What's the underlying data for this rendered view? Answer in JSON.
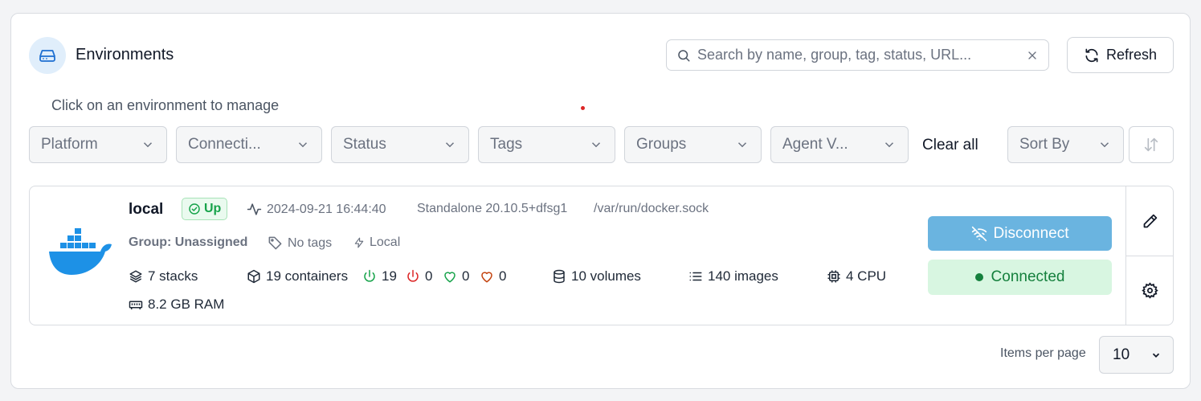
{
  "header": {
    "title": "Environments",
    "subtitle": "Click on an environment to manage",
    "search_placeholder": "Search by name, group, tag, status, URL...",
    "refresh_label": "Refresh"
  },
  "filters": {
    "items": [
      "Platform",
      "Connecti...",
      "Status",
      "Tags",
      "Groups",
      "Agent V..."
    ],
    "clear_all": "Clear all",
    "sort_by": "Sort By"
  },
  "environment": {
    "name": "local",
    "status": "Up",
    "heartbeat": "2024-09-21 16:44:40",
    "type": "Standalone 20.10.5+dfsg1",
    "url": "/var/run/docker.sock",
    "group": "Group: Unassigned",
    "tags": "No tags",
    "location": "Local",
    "stacks": "7 stacks",
    "containers": "19 containers",
    "running": "19",
    "stopped": "0",
    "healthy": "0",
    "unhealthy": "0",
    "volumes": "10 volumes",
    "images": "140 images",
    "cpu": "4 CPU",
    "ram": "8.2 GB RAM",
    "disconnect_label": "Disconnect",
    "connected_label": "Connected"
  },
  "pagination": {
    "label": "Items per page",
    "value": "10"
  },
  "colors": {
    "accent": "#6ab4e0",
    "success": "#16a34a",
    "danger": "#dc2626",
    "docker_blue": "#1d91e6"
  }
}
